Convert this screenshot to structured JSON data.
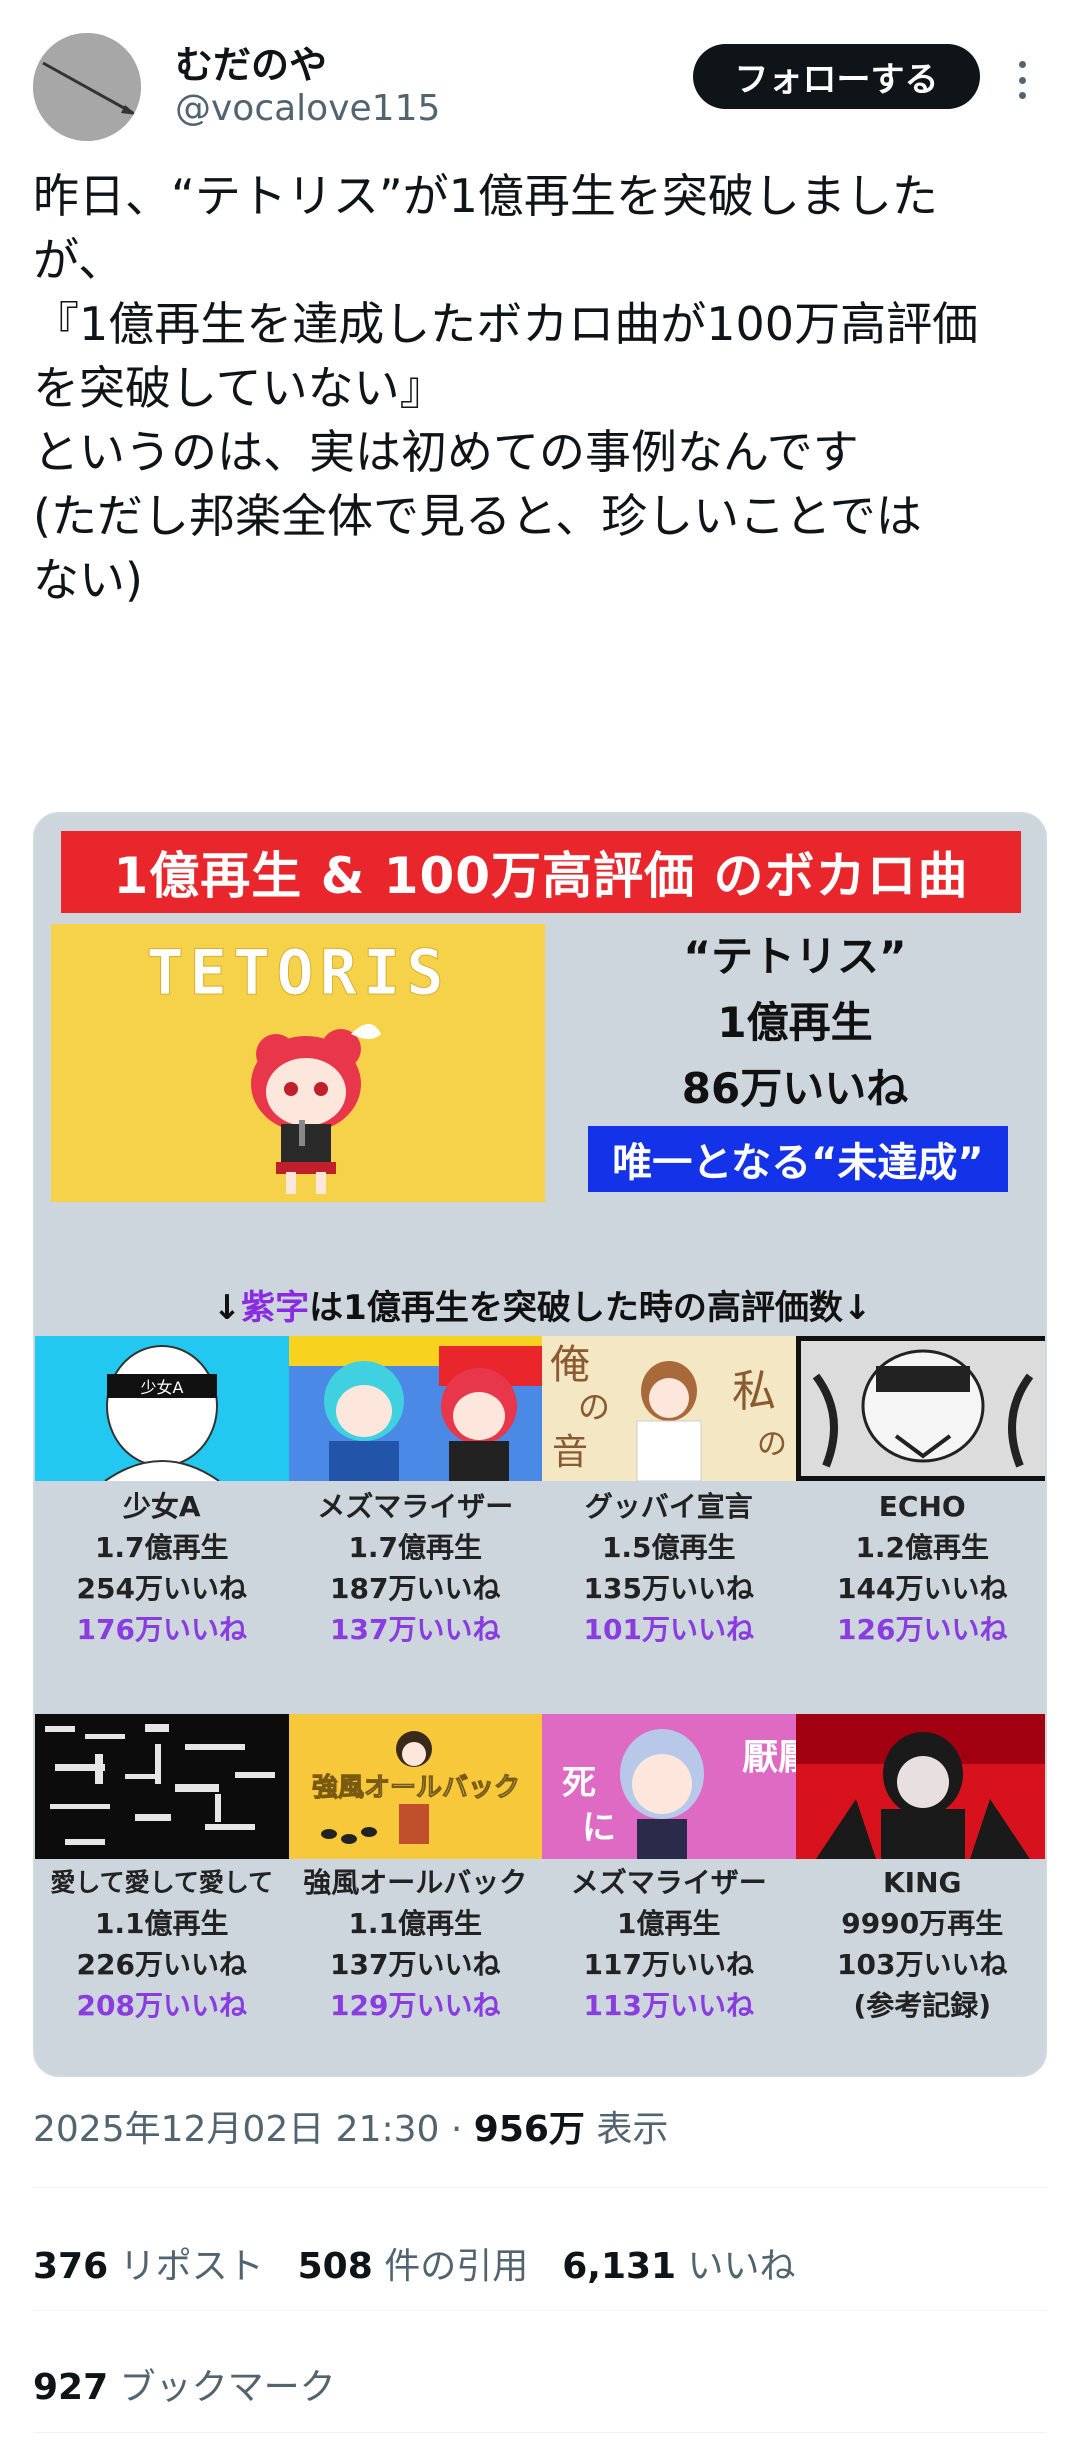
{
  "user": {
    "display_name": "むだのや",
    "handle": "@vocalove115",
    "follow_label": "フォローする"
  },
  "tweet": {
    "lines": [
      "昨日、“テトリス”が1億再生を突破しました",
      "が、",
      "",
      "『1億再生を達成したボカロ曲が100万高評価",
      "を突破していない』",
      "というのは、実は初めての事例なんです",
      "",
      "(ただし邦楽全体で見ると、珍しいことでは",
      "ない)"
    ]
  },
  "image": {
    "banner": "1億再生 & 100万高評価 のボカロ曲",
    "tetoris_logo": "TETORIS",
    "featured": {
      "title": "“テトリス”",
      "views": "1億再生",
      "likes": "86万いいね",
      "badge": "唯一となる“未達成”"
    },
    "note_prefix": "↓",
    "note_purple": "紫字",
    "note_suffix": "は1億再生を突破した時の高評価数↓",
    "thumb_texts": {
      "shoujo": "少女A",
      "ore": "俺",
      "no": "の",
      "oto": "音",
      "watashi": "私",
      "kyofu": "強風オールバック",
      "enen": "厭厭",
      "shi": "死",
      "ni": "に"
    },
    "songs_row1": [
      {
        "title": "少女A",
        "views": "1.7億再生",
        "likes": "254万いいね",
        "at_100m": "176万いいね"
      },
      {
        "title": "メズマライザー",
        "views": "1.7億再生",
        "likes": "187万いいね",
        "at_100m": "137万いいね"
      },
      {
        "title": "グッバイ宣言",
        "views": "1.5億再生",
        "likes": "135万いいね",
        "at_100m": "101万いいね"
      },
      {
        "title": "ECHO",
        "views": "1.2億再生",
        "likes": "144万いいね",
        "at_100m": "126万いいね"
      }
    ],
    "songs_row2": [
      {
        "title": "愛して愛して愛して",
        "views": "1.1億再生",
        "likes": "226万いいね",
        "at_100m": "208万いいね"
      },
      {
        "title": "強風オールバック",
        "views": "1.1億再生",
        "likes": "137万いいね",
        "at_100m": "129万いいね"
      },
      {
        "title": "メズマライザー",
        "views": "1億再生",
        "likes": "117万いいね",
        "at_100m": "113万いいね"
      },
      {
        "title": "KING",
        "views": "9990万再生",
        "likes": "103万いいね",
        "note": "(参考記録)"
      }
    ]
  },
  "meta": {
    "datetime": "2025年12月02日 21:30",
    "separator": " · ",
    "views_count": "956万",
    "views_label": " 表示"
  },
  "stats": {
    "reposts_count": "376",
    "reposts_label": " リポスト",
    "quotes_count": "508",
    "quotes_label": " 件の引用",
    "likes_count": "6,131",
    "likes_label": " いいね",
    "bookmarks_count": "927",
    "bookmarks_label": " ブックマーク"
  },
  "colors": {
    "banner_red": "#e8262c",
    "badge_blue": "#1432e8",
    "purple_text": "#8a3ce0",
    "card_bg": "#cdd6dc"
  }
}
